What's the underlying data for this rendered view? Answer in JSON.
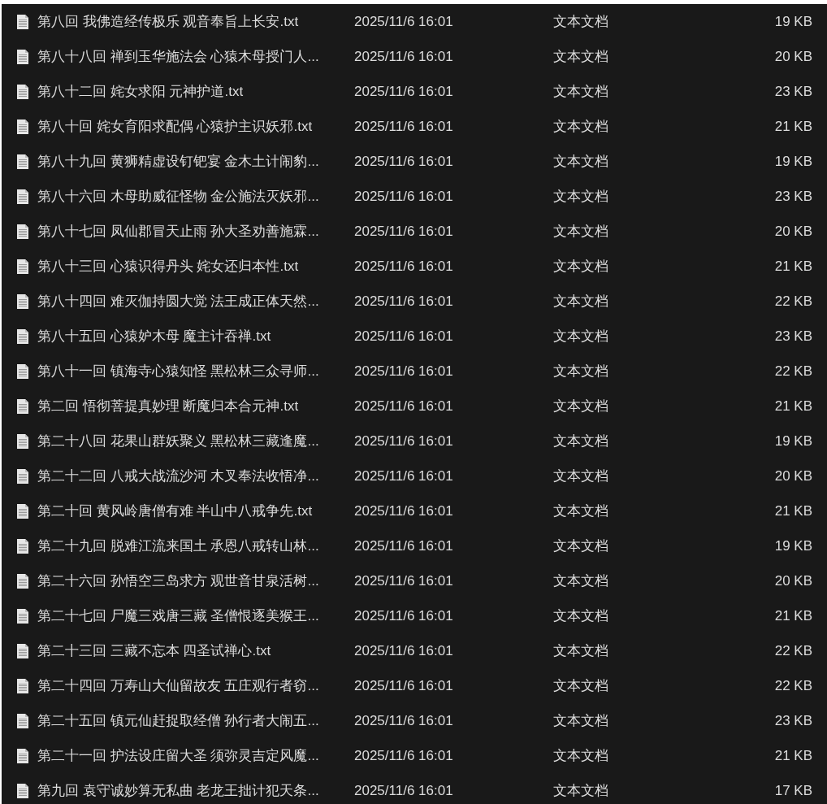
{
  "files": [
    {
      "name": "第八回 我佛造经传极乐 观音奉旨上长安.txt",
      "modified": "2025/11/6 16:01",
      "type": "文本文档",
      "size": "19 KB"
    },
    {
      "name": "第八十八回 禅到玉华施法会 心猿木母授门人...",
      "modified": "2025/11/6 16:01",
      "type": "文本文档",
      "size": "20 KB"
    },
    {
      "name": "第八十二回 姹女求阳 元神护道.txt",
      "modified": "2025/11/6 16:01",
      "type": "文本文档",
      "size": "23 KB"
    },
    {
      "name": "第八十回 姹女育阳求配偶 心猿护主识妖邪.txt",
      "modified": "2025/11/6 16:01",
      "type": "文本文档",
      "size": "21 KB"
    },
    {
      "name": "第八十九回 黄狮精虚设钉钯宴 金木土计闹豹...",
      "modified": "2025/11/6 16:01",
      "type": "文本文档",
      "size": "19 KB"
    },
    {
      "name": "第八十六回 木母助威征怪物 金公施法灭妖邪...",
      "modified": "2025/11/6 16:01",
      "type": "文本文档",
      "size": "23 KB"
    },
    {
      "name": "第八十七回 凤仙郡冒天止雨 孙大圣劝善施霖...",
      "modified": "2025/11/6 16:01",
      "type": "文本文档",
      "size": "20 KB"
    },
    {
      "name": "第八十三回 心猿识得丹头 姹女还归本性.txt",
      "modified": "2025/11/6 16:01",
      "type": "文本文档",
      "size": "21 KB"
    },
    {
      "name": "第八十四回 难灭伽持圆大觉 法王成正体天然...",
      "modified": "2025/11/6 16:01",
      "type": "文本文档",
      "size": "22 KB"
    },
    {
      "name": "第八十五回 心猿妒木母 魔主计吞禅.txt",
      "modified": "2025/11/6 16:01",
      "type": "文本文档",
      "size": "23 KB"
    },
    {
      "name": "第八十一回 镇海寺心猿知怪 黑松林三众寻师...",
      "modified": "2025/11/6 16:01",
      "type": "文本文档",
      "size": "22 KB"
    },
    {
      "name": "第二回 悟彻菩提真妙理 断魔归本合元神.txt",
      "modified": "2025/11/6 16:01",
      "type": "文本文档",
      "size": "21 KB"
    },
    {
      "name": "第二十八回 花果山群妖聚义 黑松林三藏逢魔...",
      "modified": "2025/11/6 16:01",
      "type": "文本文档",
      "size": "19 KB"
    },
    {
      "name": "第二十二回 八戒大战流沙河 木叉奉法收悟净...",
      "modified": "2025/11/6 16:01",
      "type": "文本文档",
      "size": "20 KB"
    },
    {
      "name": "第二十回 黄风岭唐僧有难 半山中八戒争先.txt",
      "modified": "2025/11/6 16:01",
      "type": "文本文档",
      "size": "21 KB"
    },
    {
      "name": "第二十九回 脱难江流来国土 承恩八戒转山林...",
      "modified": "2025/11/6 16:01",
      "type": "文本文档",
      "size": "19 KB"
    },
    {
      "name": "第二十六回 孙悟空三岛求方 观世音甘泉活树...",
      "modified": "2025/11/6 16:01",
      "type": "文本文档",
      "size": "20 KB"
    },
    {
      "name": "第二十七回 尸魔三戏唐三藏 圣僧恨逐美猴王...",
      "modified": "2025/11/6 16:01",
      "type": "文本文档",
      "size": "21 KB"
    },
    {
      "name": "第二十三回 三藏不忘本 四圣试禅心.txt",
      "modified": "2025/11/6 16:01",
      "type": "文本文档",
      "size": "22 KB"
    },
    {
      "name": "第二十四回 万寿山大仙留故友 五庄观行者窃...",
      "modified": "2025/11/6 16:01",
      "type": "文本文档",
      "size": "22 KB"
    },
    {
      "name": "第二十五回 镇元仙赶捉取经僧 孙行者大闹五...",
      "modified": "2025/11/6 16:01",
      "type": "文本文档",
      "size": "23 KB"
    },
    {
      "name": "第二十一回 护法设庄留大圣 须弥灵吉定风魔...",
      "modified": "2025/11/6 16:01",
      "type": "文本文档",
      "size": "21 KB"
    },
    {
      "name": "第九回 袁守诚妙算无私曲 老龙王拙计犯天条...",
      "modified": "2025/11/6 16:01",
      "type": "文本文档",
      "size": "17 KB"
    }
  ]
}
